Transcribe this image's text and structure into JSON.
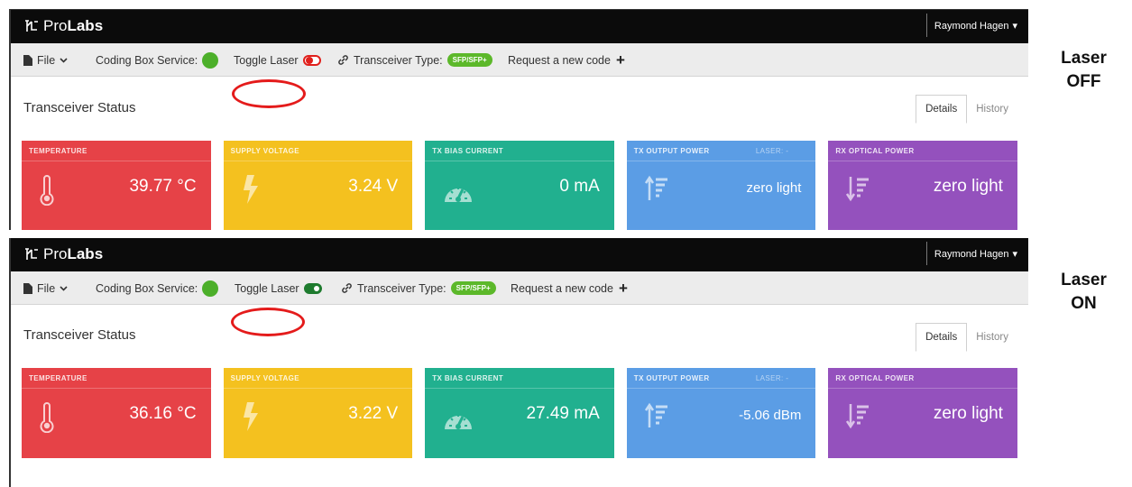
{
  "panels": [
    {
      "brand": {
        "part1": "Pro",
        "part2": "Labs"
      },
      "user": {
        "name": "Raymond Hagen",
        "caret": "▾"
      },
      "toolbar": {
        "file_label": "File",
        "coding_box_label": "Coding Box Service:",
        "toggle_laser_label": "Toggle Laser",
        "toggle_state": "off",
        "transceiver_type_label": "Transceiver Type:",
        "transceiver_type_value": "SFP/SFP+",
        "request_code_label": "Request a new code",
        "plus": "+"
      },
      "status_title": "Transceiver Status",
      "tabs": [
        {
          "label": "Details",
          "active": true
        },
        {
          "label": "History",
          "active": false
        }
      ],
      "cards": [
        {
          "title": "TEMPERATURE",
          "value": "39.77 °C",
          "color": "#e64247",
          "icon": "thermometer-icon"
        },
        {
          "title": "SUPPLY VOLTAGE",
          "value": "3.24 V",
          "color": "#f4c11f",
          "icon": "lightning-icon"
        },
        {
          "title": "TX BIAS CURRENT",
          "value": "0 mA",
          "color": "#21b08f",
          "icon": "gauge-icon"
        },
        {
          "title": "TX OUTPUT POWER",
          "laser_label": "LASER: -",
          "value": "zero light",
          "color": "#5b9de5",
          "icon": "sort-up-icon"
        },
        {
          "title": "RX OPTICAL POWER",
          "value": "zero light",
          "color": "#9451bd",
          "icon": "sort-down-icon"
        }
      ],
      "side_label": {
        "line1": "Laser",
        "line2": "OFF"
      }
    },
    {
      "brand": {
        "part1": "Pro",
        "part2": "Labs"
      },
      "user": {
        "name": "Raymond Hagen",
        "caret": "▾"
      },
      "toolbar": {
        "file_label": "File",
        "coding_box_label": "Coding Box Service:",
        "toggle_laser_label": "Toggle Laser",
        "toggle_state": "on",
        "transceiver_type_label": "Transceiver Type:",
        "transceiver_type_value": "SFP/SFP+",
        "request_code_label": "Request a new code",
        "plus": "+"
      },
      "status_title": "Transceiver Status",
      "tabs": [
        {
          "label": "Details",
          "active": true
        },
        {
          "label": "History",
          "active": false
        }
      ],
      "cards": [
        {
          "title": "TEMPERATURE",
          "value": "36.16 °C",
          "color": "#e64247",
          "icon": "thermometer-icon"
        },
        {
          "title": "SUPPLY VOLTAGE",
          "value": "3.22 V",
          "color": "#f4c11f",
          "icon": "lightning-icon"
        },
        {
          "title": "TX BIAS CURRENT",
          "value": "27.49 mA",
          "color": "#21b08f",
          "icon": "gauge-icon"
        },
        {
          "title": "TX OUTPUT POWER",
          "laser_label": "LASER: -",
          "value": "-5.06 dBm",
          "color": "#5b9de5",
          "icon": "sort-up-icon"
        },
        {
          "title": "RX OPTICAL POWER",
          "value": "zero light",
          "color": "#9451bd",
          "icon": "sort-down-icon"
        }
      ],
      "side_label": {
        "line1": "Laser",
        "line2": "ON"
      }
    }
  ]
}
